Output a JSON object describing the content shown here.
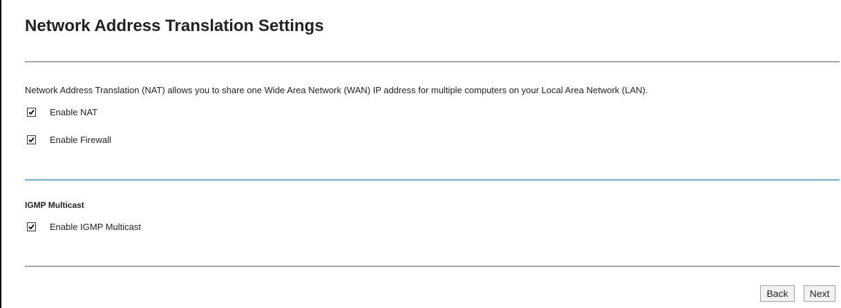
{
  "page": {
    "title": "Network Address Translation Settings",
    "description": "Network Address Translation (NAT) allows you to share one Wide Area Network (WAN) IP address for multiple computers on your Local Area Network (LAN)."
  },
  "nat": {
    "enable_nat": {
      "label": "Enable NAT",
      "checked": true
    },
    "enable_firewall": {
      "label": "Enable Firewall",
      "checked": true
    }
  },
  "igmp": {
    "section_title": "IGMP Multicast",
    "enable_igmp": {
      "label": "Enable IGMP Multicast",
      "checked": true
    }
  },
  "buttons": {
    "back": "Back",
    "next": "Next"
  },
  "colors": {
    "divider": "#1f6aa6",
    "text": "#222222"
  }
}
